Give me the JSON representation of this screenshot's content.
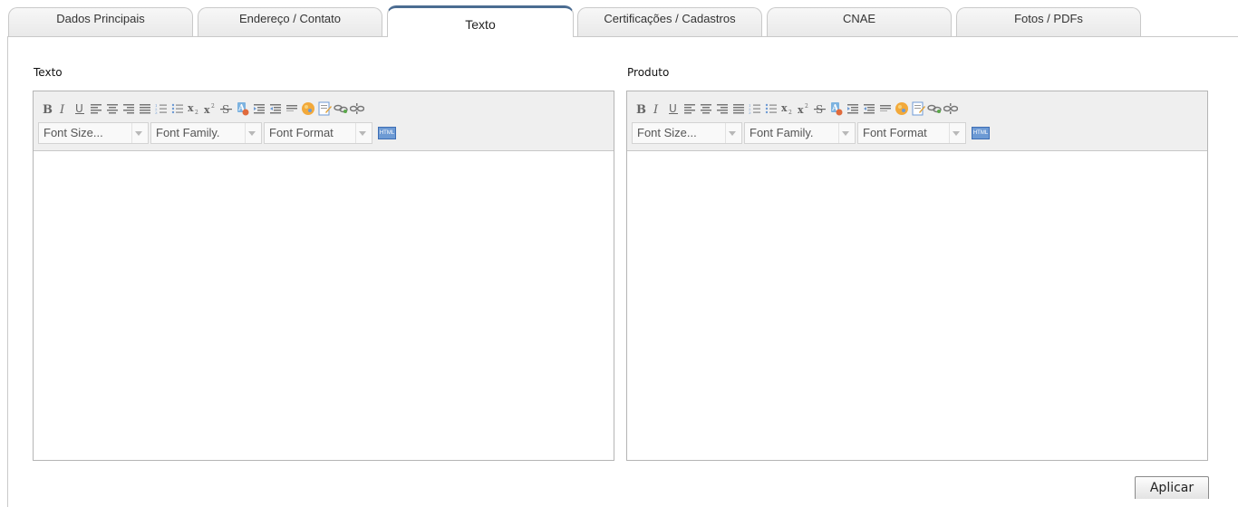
{
  "tabs": [
    {
      "label": "Dados Principais",
      "active": false
    },
    {
      "label": "Endereço / Contato",
      "active": false
    },
    {
      "label": "Texto",
      "active": true
    },
    {
      "label": "Certificações / Cadastros",
      "active": false
    },
    {
      "label": "CNAE",
      "active": false
    },
    {
      "label": "Fotos / PDFs",
      "active": false
    }
  ],
  "editors": [
    {
      "label": "Texto",
      "font_size_select": "Font Size...",
      "font_family_select": "Font Family.",
      "font_format_select": "Font Format",
      "html_button": "HTML",
      "content": ""
    },
    {
      "label": "Produto",
      "font_size_select": "Font Size...",
      "font_family_select": "Font Family.",
      "font_format_select": "Font Format",
      "html_button": "HTML",
      "content": ""
    }
  ],
  "toolbar_buttons": [
    "bold",
    "italic",
    "underline",
    "align-left",
    "align-center",
    "align-right",
    "align-justify",
    "ordered-list",
    "unordered-list",
    "subscript",
    "superscript",
    "strikethrough",
    "remove-format",
    "indent",
    "outdent",
    "horizontal-rule",
    "image",
    "insert-text",
    "link",
    "unlink"
  ],
  "apply_button": "Aplicar",
  "colors": {
    "active_tab_top": "#4b6c91",
    "toolbar_bg": "#efefef",
    "html_button": "#6d9ad4"
  }
}
